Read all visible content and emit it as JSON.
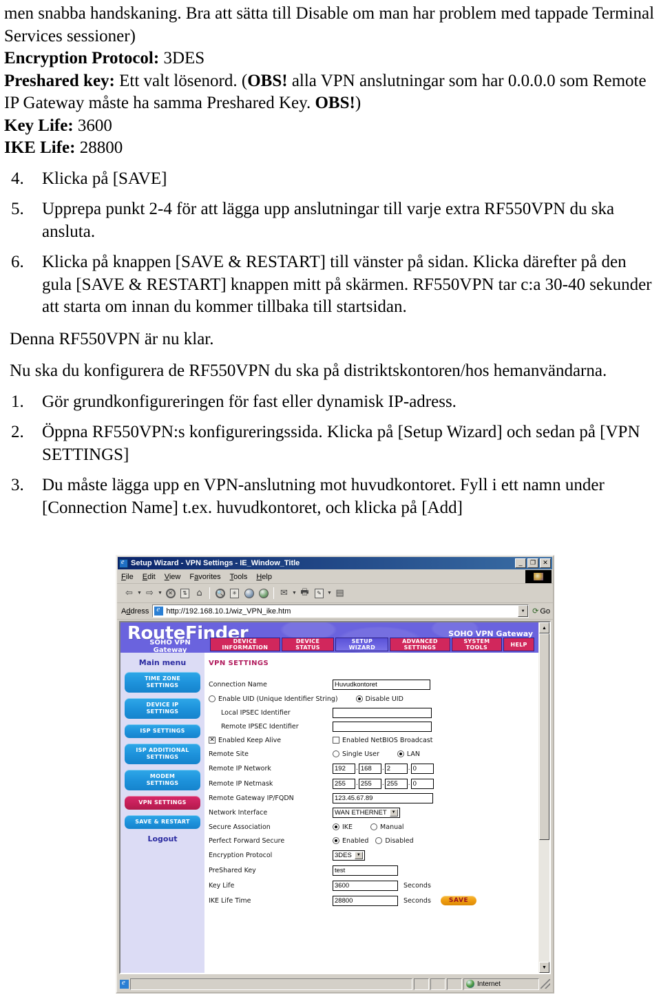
{
  "document": {
    "blocks": [
      {
        "type": "para",
        "runs": [
          {
            "t": "men snabba handskaning. Bra att sätta till Disable om man har problem med tappade Terminal Services sessioner)"
          }
        ]
      },
      {
        "type": "para",
        "runs": [
          {
            "t": "Encryption Protocol:",
            "b": true
          },
          {
            "t": " 3DES"
          }
        ]
      },
      {
        "type": "para",
        "runs": [
          {
            "t": "Preshared key:",
            "b": true
          },
          {
            "t": " Ett valt lösenord. ("
          },
          {
            "t": "OBS!",
            "b": true
          },
          {
            "t": " alla VPN anslutningar som har 0.0.0.0 som Remote IP Gateway måste ha samma Preshared Key. "
          },
          {
            "t": "OBS!",
            "b": true
          },
          {
            "t": ")"
          }
        ]
      },
      {
        "type": "para",
        "runs": [
          {
            "t": "Key Life:",
            "b": true
          },
          {
            "t": " 3600"
          }
        ]
      },
      {
        "type": "para",
        "runs": [
          {
            "t": "IKE Life:",
            "b": true
          },
          {
            "t": " 28800"
          }
        ]
      },
      {
        "type": "list",
        "num": "4.",
        "runs": [
          {
            "t": "Klicka på [SAVE]"
          }
        ]
      },
      {
        "type": "list",
        "num": "5.",
        "runs": [
          {
            "t": "Upprepa punkt 2-4 för att lägga upp anslutningar till varje extra RF550VPN du ska ansluta."
          }
        ]
      },
      {
        "type": "list",
        "num": "6.",
        "runs": [
          {
            "t": "Klicka på knappen [SAVE & RESTART] till vänster på sidan. Klicka därefter på den gula [SAVE & RESTART] knappen mitt på skärmen. RF550VPN tar c:a 30-40 sekunder att starta om innan du kommer tillbaka till startsidan."
          }
        ]
      },
      {
        "type": "plain",
        "runs": [
          {
            "t": "Denna RF550VPN är nu klar."
          }
        ]
      },
      {
        "type": "plain",
        "runs": [
          {
            "t": "Nu ska du konfigurera de RF550VPN du ska på distriktskontoren/hos hemanvändarna."
          }
        ]
      },
      {
        "type": "list",
        "num": "1.",
        "runs": [
          {
            "t": "Gör grundkonfigureringen för fast eller dynamisk IP-adress."
          }
        ]
      },
      {
        "type": "list",
        "num": "2.",
        "runs": [
          {
            "t": "Öppna RF550VPN:s konfigureringssida. Klicka på [Setup Wizard] och sedan på [VPN SETTINGS]"
          }
        ]
      },
      {
        "type": "list",
        "num": "3.",
        "runs": [
          {
            "t": "Du måste lägga upp en VPN-anslutning mot huvudkontoret. Fyll i ett namn under [Connection Name] t.ex. huvudkontoret, och klicka på [Add]"
          }
        ]
      }
    ]
  },
  "browser": {
    "title": "Setup Wizard - VPN Settings - IE_Window_Title",
    "window_buttons": {
      "minimize": "_",
      "maximize": "❐",
      "close": "✕"
    },
    "menu": [
      "File",
      "Edit",
      "View",
      "Favorites",
      "Tools",
      "Help"
    ],
    "address_label": "Address",
    "address_value": "http://192.168.10.1/wiz_VPN_ike.htm",
    "go_label": "Go",
    "toolbar_icons": [
      "back-icon",
      "back-dropdown-icon",
      "forward-icon",
      "forward-dropdown-icon",
      "stop-icon",
      "refresh-icon",
      "home-icon",
      "search-icon",
      "favorites-icon",
      "history-icon",
      "media-icon",
      "mail-icon",
      "mail-dropdown-icon",
      "print-icon",
      "edit-icon",
      "edit-dropdown-icon",
      "discuss-icon"
    ],
    "status": {
      "main": "",
      "zone": "Internet"
    }
  },
  "app": {
    "logo": "RouteFinder",
    "logo_sub": "SOHO VPN Gateway",
    "tagline": "SOHO VPN Gateway",
    "nav_tabs": [
      {
        "label": "DEVICE\nINFORMATION",
        "line1": "DEVICE",
        "line2": "INFORMATION",
        "active": false
      },
      {
        "label": "DEVICE STATUS",
        "line1": "DEVICE",
        "line2": "STATUS",
        "active": false
      },
      {
        "label": "SETUP WIZARD",
        "line1": "SETUP",
        "line2": "WIZARD",
        "active": true
      },
      {
        "label": "ADVANCED SETTINGS",
        "line1": "ADVANCED",
        "line2": "SETTINGS",
        "active": false
      },
      {
        "label": "SYSTEM TOOLS",
        "line1": "SYSTEM",
        "line2": "TOOLS",
        "active": false
      },
      {
        "label": "HELP",
        "line1": "HELP",
        "line2": "",
        "active": false
      }
    ],
    "sidebar": {
      "title": "Main menu",
      "items": [
        {
          "line1": "TIME ZONE",
          "line2": "SETTINGS",
          "active": false
        },
        {
          "line1": "DEVICE IP",
          "line2": "SETTINGS",
          "active": false
        },
        {
          "line1": "ISP SETTINGS",
          "line2": "",
          "active": false
        },
        {
          "line1": "ISP ADDITIONAL",
          "line2": "SETTINGS",
          "active": false
        },
        {
          "line1": "MODEM",
          "line2": "SETTINGS",
          "active": false
        },
        {
          "line1": "VPN SETTINGS",
          "line2": "",
          "active": true
        },
        {
          "line1": "SAVE & RESTART",
          "line2": "",
          "active": false
        }
      ],
      "logout": "Logout"
    },
    "form": {
      "title": "VPN SETTINGS",
      "connection_name_label": "Connection Name",
      "connection_name_value": "Huvudkontoret",
      "enable_uid_label": "Enable UID (Unique Identifier String)",
      "disable_uid_label": "Disable UID",
      "uid_selected": "disable",
      "local_ipsec_label": "Local IPSEC Identifier",
      "local_ipsec_value": "",
      "remote_ipsec_label": "Remote IPSEC Identifier",
      "remote_ipsec_value": "",
      "keep_alive_label": "Enabled Keep Alive",
      "keep_alive_checked": true,
      "netbios_label": "Enabled NetBIOS Broadcast",
      "netbios_checked": false,
      "remote_site_label": "Remote Site",
      "remote_site_single": "Single User",
      "remote_site_lan": "LAN",
      "remote_site_selected": "LAN",
      "remote_ip_network_label": "Remote IP Network",
      "remote_ip_network": [
        "192",
        "168",
        "2",
        "0"
      ],
      "remote_ip_netmask_label": "Remote IP Netmask",
      "remote_ip_netmask": [
        "255",
        "255",
        "255",
        "0"
      ],
      "remote_gateway_label": "Remote Gateway IP/FQDN",
      "remote_gateway_value": "123.45.67.89",
      "network_interface_label": "Network Interface",
      "network_interface_value": "WAN ETHERNET",
      "secure_association_label": "Secure Association",
      "secure_ike": "IKE",
      "secure_manual": "Manual",
      "secure_selected": "IKE",
      "pfs_label": "Perfect Forward Secure",
      "pfs_enabled": "Enabled",
      "pfs_disabled": "Disabled",
      "pfs_selected": "Enabled",
      "encryption_protocol_label": "Encryption Protocol",
      "encryption_protocol_value": "3DES",
      "preshared_key_label": "PreShared Key",
      "preshared_key_value": "test",
      "key_life_label": "Key Life",
      "key_life_value": "3600",
      "key_life_unit": "Seconds",
      "ike_life_label": "IKE Life Time",
      "ike_life_value": "28800",
      "ike_life_unit": "Seconds",
      "save_label": "SAVE"
    }
  }
}
